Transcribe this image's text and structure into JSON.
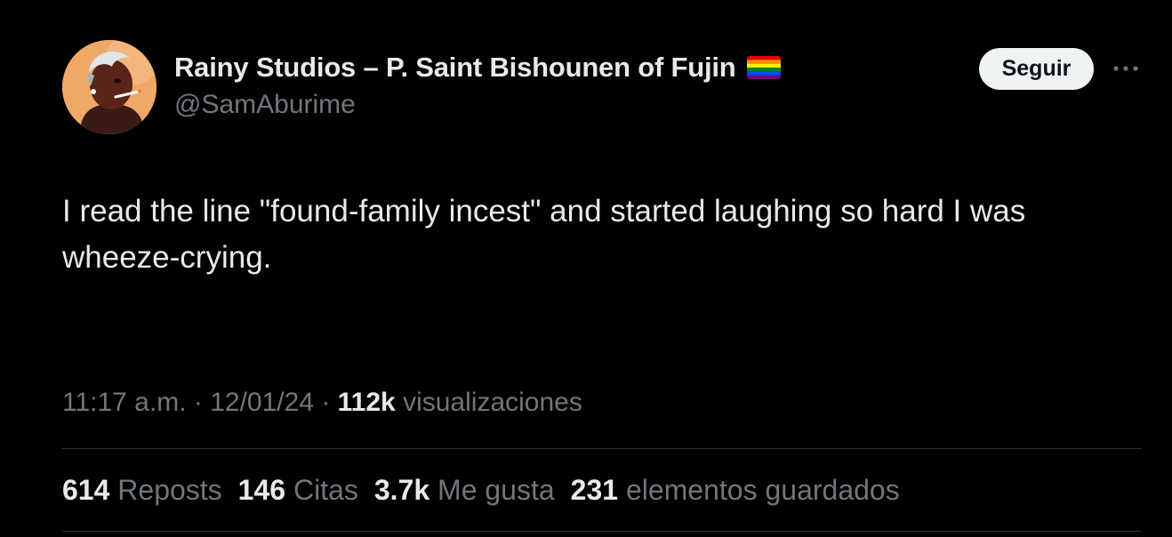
{
  "author": {
    "display_name": "Rainy Studios – P. Saint Bishounen of Fujin",
    "handle": "@SamAburime",
    "avatar_icon": "profile-avatar",
    "badge_icon": "rainbow-flag-icon"
  },
  "actions": {
    "follow_label": "Seguir",
    "more_icon": "more-dots-icon"
  },
  "tweet": {
    "text": "I read the line \"found-family incest\" and started laughing so hard I was wheeze-crying."
  },
  "meta": {
    "time": "11:17 a.m.",
    "separator1": " · ",
    "date": "12/01/24",
    "separator2": " · ",
    "views_count": "112k",
    "views_label": " visualizaciones"
  },
  "stats": [
    {
      "count": "614",
      "label": "Reposts"
    },
    {
      "count": "146",
      "label": "Citas"
    },
    {
      "count": "3.7k",
      "label": "Me gusta"
    },
    {
      "count": "231",
      "label": "elementos guardados"
    }
  ],
  "colors": {
    "background": "#000000",
    "primary_text": "#e7e9ea",
    "secondary_text": "#71767b",
    "divider": "#2f3336",
    "follow_bg": "#eff3f4",
    "follow_text": "#0f1419"
  }
}
